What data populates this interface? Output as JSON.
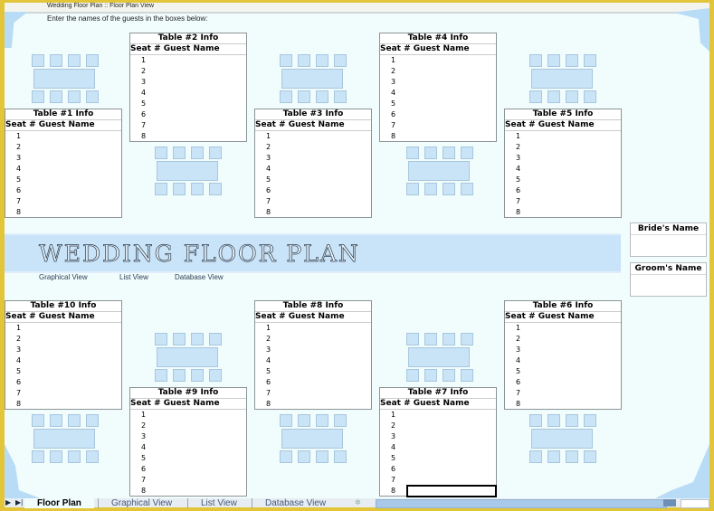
{
  "header": {
    "breadcrumb": "Wedding Floor Plan :: Floor Plan View",
    "instructions": "Enter the names of the guests in the boxes below:"
  },
  "table_labels": {
    "seat_header": "Seat # Guest Name"
  },
  "tables": [
    {
      "title": "Table #1 Info",
      "seats": [
        "1",
        "2",
        "3",
        "4",
        "5",
        "6",
        "7",
        "8"
      ],
      "guests": [
        "",
        "",
        "",
        "",
        "",
        "",
        "",
        ""
      ]
    },
    {
      "title": "Table #2 Info",
      "seats": [
        "1",
        "2",
        "3",
        "4",
        "5",
        "6",
        "7",
        "8"
      ],
      "guests": [
        "",
        "",
        "",
        "",
        "",
        "",
        "",
        ""
      ]
    },
    {
      "title": "Table #3 Info",
      "seats": [
        "1",
        "2",
        "3",
        "4",
        "5",
        "6",
        "7",
        "8"
      ],
      "guests": [
        "",
        "",
        "",
        "",
        "",
        "",
        "",
        ""
      ]
    },
    {
      "title": "Table #4 Info",
      "seats": [
        "1",
        "2",
        "3",
        "4",
        "5",
        "6",
        "7",
        "8"
      ],
      "guests": [
        "",
        "",
        "",
        "",
        "",
        "",
        "",
        ""
      ]
    },
    {
      "title": "Table #5 Info",
      "seats": [
        "1",
        "2",
        "3",
        "4",
        "5",
        "6",
        "7",
        "8"
      ],
      "guests": [
        "",
        "",
        "",
        "",
        "",
        "",
        "",
        ""
      ]
    },
    {
      "title": "Table #6 Info",
      "seats": [
        "1",
        "2",
        "3",
        "4",
        "5",
        "6",
        "7",
        "8"
      ],
      "guests": [
        "",
        "",
        "",
        "",
        "",
        "",
        "",
        ""
      ]
    },
    {
      "title": "Table #7 Info",
      "seats": [
        "1",
        "2",
        "3",
        "4",
        "5",
        "6",
        "7",
        "8"
      ],
      "guests": [
        "",
        "",
        "",
        "",
        "",
        "",
        "",
        ""
      ]
    },
    {
      "title": "Table #8 Info",
      "seats": [
        "1",
        "2",
        "3",
        "4",
        "5",
        "6",
        "7",
        "8"
      ],
      "guests": [
        "",
        "",
        "",
        "",
        "",
        "",
        "",
        ""
      ]
    },
    {
      "title": "Table #9 Info",
      "seats": [
        "1",
        "2",
        "3",
        "4",
        "5",
        "6",
        "7",
        "8"
      ],
      "guests": [
        "",
        "",
        "",
        "",
        "",
        "",
        "",
        ""
      ]
    },
    {
      "title": "Table #10 Info",
      "seats": [
        "1",
        "2",
        "3",
        "4",
        "5",
        "6",
        "7",
        "8"
      ],
      "guests": [
        "",
        "",
        "",
        "",
        "",
        "",
        "",
        ""
      ]
    }
  ],
  "banner": {
    "title": "WEDDING FLOOR PLAN",
    "links": [
      "Graphical View",
      "List View",
      "Database View"
    ]
  },
  "couple": {
    "bride_label": "Bride's Name",
    "bride_value": "",
    "groom_label": "Groom's Name",
    "groom_value": ""
  },
  "sheet_tabs": {
    "nav_next": "▶",
    "nav_last": "▶|",
    "tabs": [
      "Floor Plan",
      "Graphical View",
      "List View",
      "Database View"
    ],
    "active_index": 0,
    "insert_icon": "new-sheet-icon"
  },
  "colors": {
    "window_frame": "#e3c53a",
    "sheet_bg": "#f1fcfd",
    "accent_blue": "#c9e3f9",
    "chair_fill": "#c9e3f7"
  }
}
